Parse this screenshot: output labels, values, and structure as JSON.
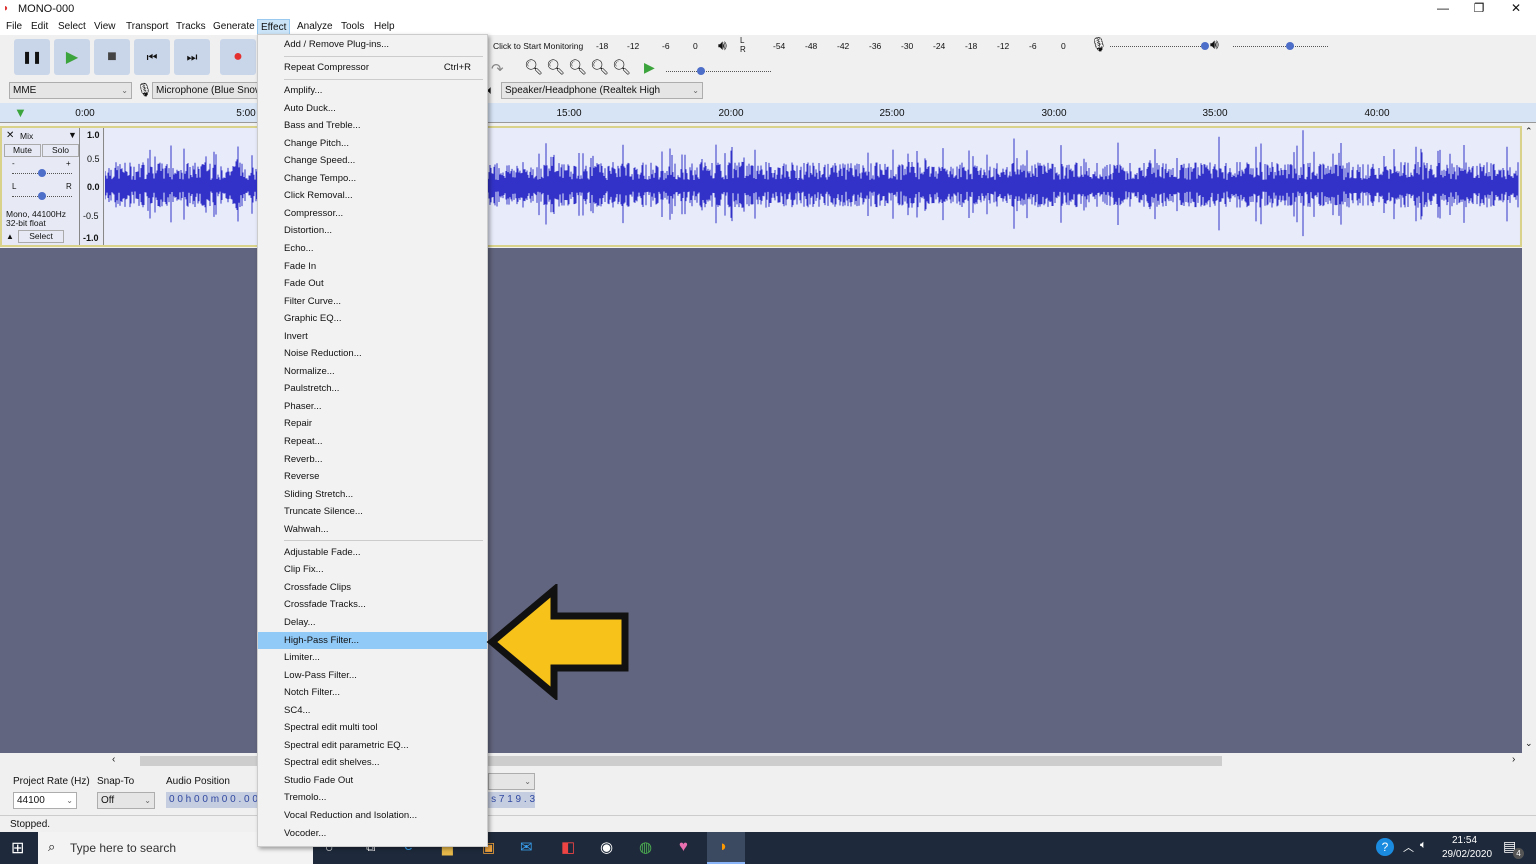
{
  "window": {
    "title": "MONO-000",
    "controls": [
      "—",
      "❐",
      "✕"
    ]
  },
  "menubar": [
    "File",
    "Edit",
    "Select",
    "View",
    "Transport",
    "Tracks",
    "Generate",
    "Effect",
    "Analyze",
    "Tools",
    "Help"
  ],
  "menubar_active": "Effect",
  "transport": {
    "pause": "❚❚",
    "play": "▶",
    "stop": "■",
    "skip_start": "⏮",
    "skip_end": "⏭",
    "record": "●"
  },
  "meters": {
    "record_hint": "Click to Start Monitoring",
    "record_ticks": [
      "-18",
      "-12",
      "-6",
      "0"
    ],
    "play_ticks": [
      "-54",
      "-48",
      "-42",
      "-36",
      "-30",
      "-24",
      "-18",
      "-12",
      "-6",
      "0"
    ],
    "lr": [
      "L",
      "R"
    ]
  },
  "devices": {
    "host": "MME",
    "mic": "Microphone (Blue Snow",
    "speaker": "Speaker/Headphone (Realtek High"
  },
  "ruler": [
    "0:00",
    "5:00",
    "15:00",
    "20:00",
    "25:00",
    "30:00",
    "35:00",
    "40:00"
  ],
  "track": {
    "name": "Mix",
    "mute": "Mute",
    "solo": "Solo",
    "info1": "Mono, 44100Hz",
    "info2": "32-bit float",
    "select": "Select",
    "scale": [
      "1.0",
      "0.5",
      "0.0",
      "-0.5",
      "-1.0"
    ],
    "gain_labels": [
      "-",
      "+"
    ],
    "pan_labels": [
      "L",
      "R"
    ]
  },
  "selection": {
    "rate_label": "Project Rate (Hz)",
    "rate": "44100",
    "snap_label": "Snap-To",
    "snap": "Off",
    "pos_label": "Audio Position",
    "pos": "0 0 h 0 0 m 0 0 . 0 0",
    "end": "3 . 9 1 7 s"
  },
  "status": "Stopped.",
  "taskbar": {
    "search": "Type here to search",
    "time": "21:54",
    "date": "29/02/2020",
    "notifications": "4"
  },
  "effect_menu": [
    {
      "label": "Add / Remove Plug-ins..."
    },
    {
      "sep": true
    },
    {
      "label": "Repeat Compressor",
      "shortcut": "Ctrl+R"
    },
    {
      "sep": true
    },
    {
      "label": "Amplify..."
    },
    {
      "label": "Auto Duck..."
    },
    {
      "label": "Bass and Treble..."
    },
    {
      "label": "Change Pitch..."
    },
    {
      "label": "Change Speed..."
    },
    {
      "label": "Change Tempo..."
    },
    {
      "label": "Click Removal..."
    },
    {
      "label": "Compressor..."
    },
    {
      "label": "Distortion..."
    },
    {
      "label": "Echo..."
    },
    {
      "label": "Fade In"
    },
    {
      "label": "Fade Out"
    },
    {
      "label": "Filter Curve..."
    },
    {
      "label": "Graphic EQ..."
    },
    {
      "label": "Invert"
    },
    {
      "label": "Noise Reduction..."
    },
    {
      "label": "Normalize..."
    },
    {
      "label": "Paulstretch..."
    },
    {
      "label": "Phaser..."
    },
    {
      "label": "Repair"
    },
    {
      "label": "Repeat..."
    },
    {
      "label": "Reverb..."
    },
    {
      "label": "Reverse"
    },
    {
      "label": "Sliding Stretch..."
    },
    {
      "label": "Truncate Silence..."
    },
    {
      "label": "Wahwah..."
    },
    {
      "sep": true
    },
    {
      "label": "Adjustable Fade..."
    },
    {
      "label": "Clip Fix..."
    },
    {
      "label": "Crossfade Clips"
    },
    {
      "label": "Crossfade Tracks..."
    },
    {
      "label": "Delay..."
    },
    {
      "label": "High-Pass Filter...",
      "highlighted": true
    },
    {
      "label": "Limiter..."
    },
    {
      "label": "Low-Pass Filter..."
    },
    {
      "label": "Notch Filter..."
    },
    {
      "label": "SC4..."
    },
    {
      "label": "Spectral edit multi tool"
    },
    {
      "label": "Spectral edit parametric EQ..."
    },
    {
      "label": "Spectral edit shelves..."
    },
    {
      "label": "Studio Fade Out"
    },
    {
      "label": "Tremolo..."
    },
    {
      "label": "Vocal Reduction and Isolation..."
    },
    {
      "label": "Vocoder..."
    }
  ],
  "colors": {
    "waveform": "#3232c8",
    "highlight": "#91c9f7",
    "arrow": "#f7c21a",
    "background": "#62657f"
  }
}
